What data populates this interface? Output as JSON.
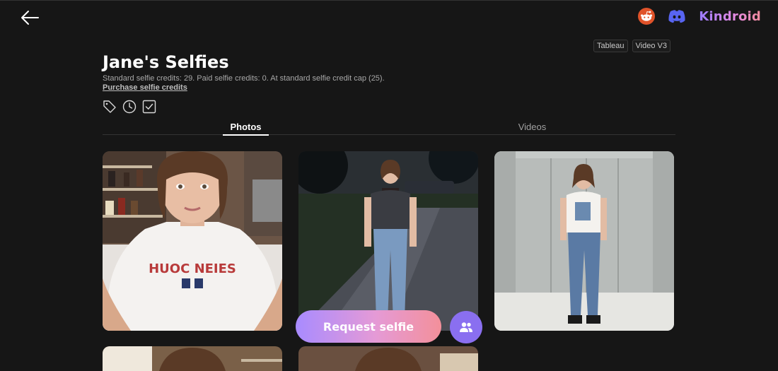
{
  "header": {
    "back_icon": "arrow-left-icon",
    "reddit_icon": "reddit-icon",
    "discord_icon": "discord-icon",
    "brand": "Kindroid",
    "brand_gradient": [
      "#9b7bff",
      "#f08a9a"
    ]
  },
  "badges": [
    "Tableau",
    "Video V3"
  ],
  "page": {
    "title": "Jane's Selfies",
    "credits_text": "Standard selfie credits: 29. Paid selfie credits: 0. At standard selfie credit cap (25).",
    "purchase_link": "Purchase selfie credits"
  },
  "filters": [
    "tag-icon",
    "clock-icon",
    "checkbox-icon"
  ],
  "tabs": [
    {
      "label": "Photos",
      "active": true
    },
    {
      "label": "Videos",
      "active": false
    }
  ],
  "photos": [
    {
      "name": "photo-coffee-selfie"
    },
    {
      "name": "photo-night-path"
    },
    {
      "name": "photo-restroom-stalls"
    },
    {
      "name": "photo-row2-left"
    },
    {
      "name": "photo-row2-middle"
    }
  ],
  "actions": {
    "request_label": "Request selfie",
    "group_icon": "group-icon",
    "accent": "#8a6ff0"
  }
}
